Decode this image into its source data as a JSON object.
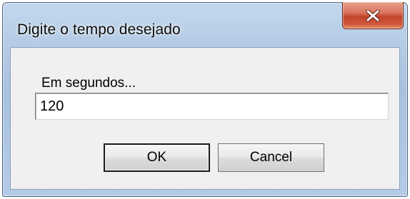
{
  "window": {
    "title": "Digite o tempo desejado"
  },
  "titlebar": {
    "close_icon": "close-x-icon",
    "close_color": "#c2432c"
  },
  "form": {
    "prompt_label": "Em segundos...",
    "input_value": "120"
  },
  "buttons": {
    "ok_label": "OK",
    "cancel_label": "Cancel"
  }
}
